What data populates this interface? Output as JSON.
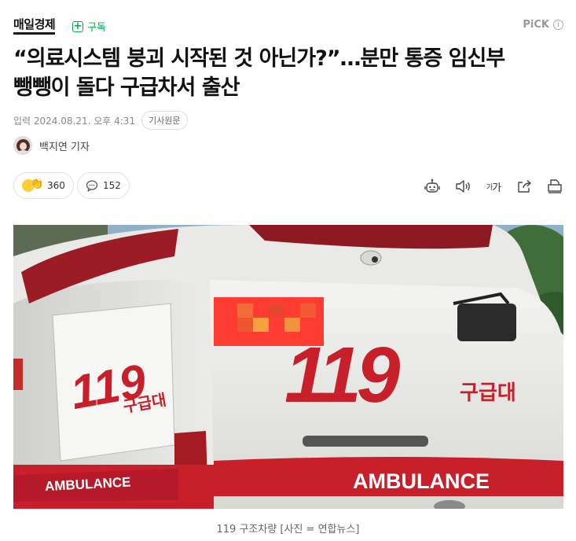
{
  "header": {
    "brand": "매일경제",
    "subscribe_label": "구독",
    "pick_label": "PiCK",
    "info_icon": "info-icon"
  },
  "article": {
    "title_line1": "“의료시스템 붕괴 시작된 것 아닌가?”…분만 통증 임신부",
    "title_line2": "뺑뺑이 돌다 구급차서 출산",
    "published": "입력 2024.08.21. 오후 4:31",
    "original_button": "기사원문",
    "reporter": "백지연 기자"
  },
  "reactions": {
    "count": "360",
    "comments": "152"
  },
  "toolbar": {
    "icons": [
      "robot-summary-icon",
      "speaker-icon",
      "font-size-icon",
      "share-icon",
      "print-icon"
    ],
    "font_size_label_small": "가",
    "font_size_label_big": "가"
  },
  "photo": {
    "text_119_left": "119",
    "text_unit_left": "구급대",
    "text_119_right": "119",
    "text_unit_right": "구급대",
    "ambulance_left": "AMBULANCE",
    "ambulance_right": "AMBULANCE",
    "caption": "119 구조차량 [사진 = 연합뉴스]"
  },
  "colors": {
    "accent_green": "#03a94d",
    "ambulance_red": "#c8202b"
  }
}
